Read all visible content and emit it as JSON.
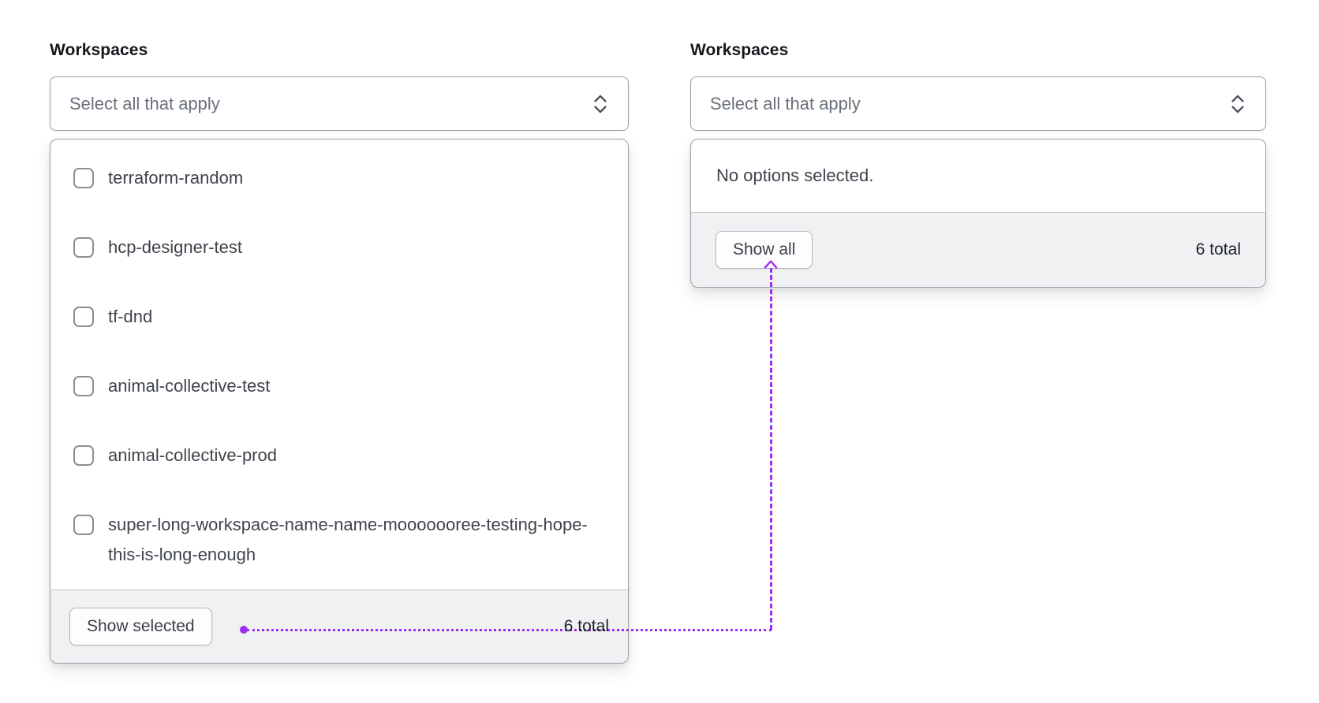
{
  "accent_color": "#9a2ff0",
  "icons": {
    "trigger_caret": "caret-sort-icon",
    "annotation_arrow": "arrow-up-icon"
  },
  "panels": [
    {
      "label": "Workspaces",
      "placeholder": "Select all that apply",
      "dropdown": {
        "options": [
          {
            "label": "terraform-random",
            "checked": false
          },
          {
            "label": "hcp-designer-test",
            "checked": false
          },
          {
            "label": "tf-dnd",
            "checked": false
          },
          {
            "label": "animal-collective-test",
            "checked": false
          },
          {
            "label": "animal-collective-prod",
            "checked": false
          },
          {
            "label": "super-long-workspace-name-name-mooooooree-testing-hope-this-is-long-enough",
            "checked": false
          }
        ],
        "footer": {
          "button_label": "Show selected",
          "total_text": "6 total"
        }
      }
    },
    {
      "label": "Workspaces",
      "placeholder": "Select all that apply",
      "dropdown": {
        "empty_text": "No options selected.",
        "footer": {
          "button_label": "Show all",
          "total_text": "6 total"
        }
      }
    }
  ]
}
